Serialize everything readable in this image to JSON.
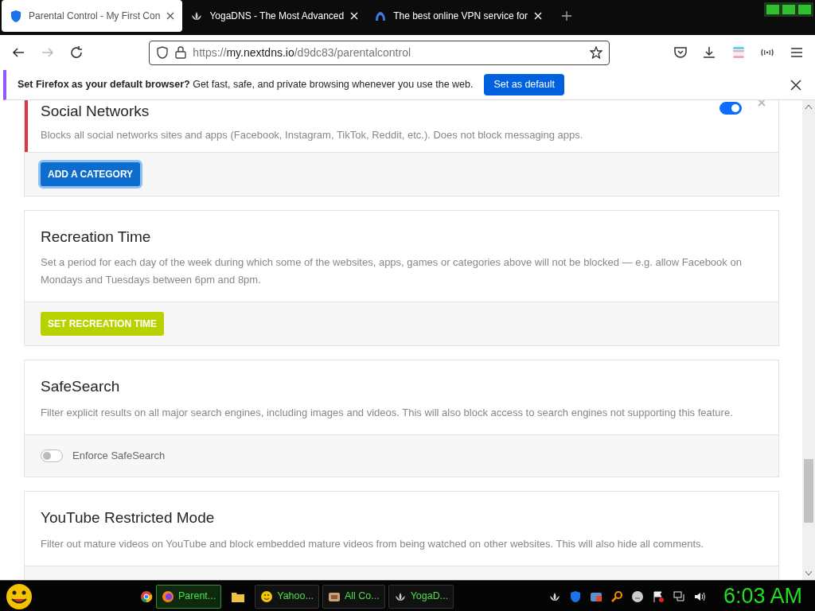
{
  "tabs": [
    {
      "title": "Parental Control - My First Con",
      "selected": true
    },
    {
      "title": "YogaDNS - The Most Advanced",
      "selected": false
    },
    {
      "title": "The best online VPN service for",
      "selected": false
    }
  ],
  "address_bar": {
    "scheme": "https://",
    "host": "my.nextdns.io",
    "path": "/d9dc83/parentalcontrol"
  },
  "notification": {
    "message": "**Set Firefox as your default browser?** Get fast, safe, and private browsing whenever you use the web.",
    "button": "Set as default"
  },
  "sections": [
    {
      "kind": "category_list",
      "items": [
        {
          "title": "Social Networks",
          "description": "Blocks all social networks sites and apps (Facebook, Instagram, TikTok, Reddit, etc.). Does not block messaging apps.",
          "on": true
        }
      ],
      "button": "ADD A CATEGORY"
    },
    {
      "kind": "card",
      "title": "Recreation Time",
      "description": "Set a period for each day of the week during which some of the websites, apps, games or categories above will not be blocked — e.g. allow Facebook on Mondays and Tuesdays between 6pm and 8pm.",
      "footer": {
        "kind": "button",
        "label": "SET RECREATION TIME"
      }
    },
    {
      "kind": "card",
      "title": "SafeSearch",
      "description": "Filter explicit results on all major search engines, including images and videos. This will also block access to search engines not supporting this feature.",
      "footer": {
        "kind": "toggle",
        "label": "Enforce SafeSearch",
        "on": false
      }
    },
    {
      "kind": "card",
      "title": "YouTube Restricted Mode",
      "description": "Filter out mature videos on YouTube and block embedded mature videos from being watched on other websites. This will also hide all comments."
    }
  ],
  "taskbar": {
    "buttons": [
      {
        "label": "Parent...",
        "selected": true
      },
      {
        "label": "Yahoo...",
        "selected": false
      },
      {
        "label": "All Co...",
        "selected": false
      },
      {
        "label": "YogaD...",
        "selected": false
      }
    ],
    "clock": "6:03 AM"
  }
}
